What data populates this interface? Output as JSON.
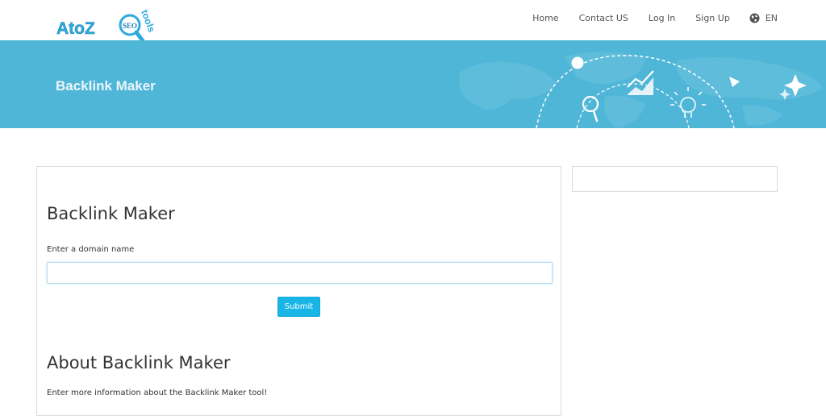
{
  "header": {
    "logo": {
      "text_main": "AtoZ",
      "text_badge": "SEO",
      "text_tools": "tools"
    },
    "nav": {
      "home": "Home",
      "contact": "Contact US",
      "login": "Log In",
      "signup": "Sign Up",
      "language": "EN"
    },
    "colors": {
      "accent": "#17b6e6",
      "banner": "#50b6d7"
    }
  },
  "banner": {
    "title": "Backlink Maker"
  },
  "main": {
    "heading": "Backlink Maker",
    "domain_label": "Enter a domain name",
    "domain_value": "",
    "submit_label": "Submit",
    "about_heading": "About Backlink Maker",
    "about_text": "Enter more information about the Backlink Maker tool!"
  },
  "icons": [
    "globe-icon",
    "magnifier-icon",
    "bar-chart-icon",
    "lightbulb-icon",
    "paper-plane-icon",
    "sparkle-icon"
  ]
}
